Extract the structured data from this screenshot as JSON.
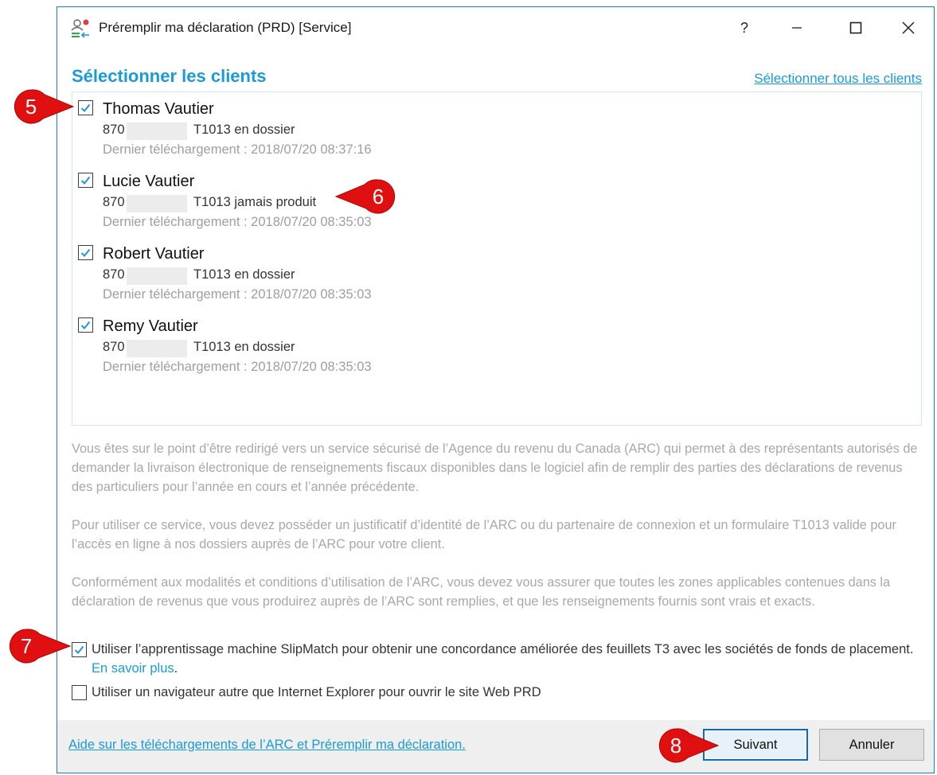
{
  "window": {
    "title": "Préremplir ma déclaration (PRD) [Service]",
    "help_label": "?",
    "accent": "#1a9bd7"
  },
  "header": {
    "title": "Sélectionner les clients",
    "select_all": "Sélectionner tous les clients"
  },
  "clients": [
    {
      "name": "Thomas Vautier",
      "sin_prefix": "870",
      "status": "T1013 en dossier",
      "last_download": "Dernier téléchargement : 2018/07/20 08:37:16",
      "checked": true
    },
    {
      "name": "Lucie Vautier",
      "sin_prefix": "870",
      "status": "T1013 jamais produit",
      "last_download": "Dernier téléchargement : 2018/07/20 08:35:03",
      "checked": true
    },
    {
      "name": "Robert Vautier",
      "sin_prefix": "870",
      "status": "T1013 en dossier",
      "last_download": "Dernier téléchargement : 2018/07/20 08:35:03",
      "checked": true
    },
    {
      "name": "Remy Vautier",
      "sin_prefix": "870",
      "status": "T1013 en dossier",
      "last_download": "Dernier téléchargement : 2018/07/20 08:35:03",
      "checked": true
    }
  ],
  "info": {
    "p1": "Vous êtes sur le point d’être redirigé vers un service sécurisé de l’Agence du revenu du Canada (ARC) qui permet à des représentants autorisés de demander la livraison électronique de renseignements fiscaux disponibles dans le logiciel afin de remplir des parties des déclarations de revenus des particuliers pour l’année en cours et l’année précédente.",
    "p2": "Pour utiliser ce service, vous devez posséder un justificatif d’identité de l’ARC ou du partenaire de connexion et un formulaire T1013 valide pour l’accès en ligne à nos dossiers auprès de l’ARC pour votre client.",
    "p3": "Conformément aux modalités et conditions d’utilisation de l’ARC, vous devez vous assurer que toutes les zones applicables contenues dans la déclaration de revenus que vous produirez auprès de l’ARC sont remplies, et que les renseignements fournis sont vrais et exacts."
  },
  "options": {
    "slipmatch_text": "Utiliser l’apprentissage machine SlipMatch pour obtenir une concordance améliorée des feuillets T3 avec les sociétés de fonds de placement.",
    "slipmatch_link": "En savoir plus",
    "slipmatch_after": ".",
    "slipmatch_checked": true,
    "browser_text": "Utiliser un navigateur autre que Internet Explorer pour ouvrir le site Web PRD",
    "browser_checked": false
  },
  "footer": {
    "help_link": "Aide sur les téléchargements de l’ARC et Préremplir ma déclaration.",
    "next_label": "Suivant",
    "cancel_label": "Annuler"
  },
  "callouts": {
    "c5": "5",
    "c6": "6",
    "c7": "7",
    "c8": "8",
    "color": "#e01010"
  }
}
